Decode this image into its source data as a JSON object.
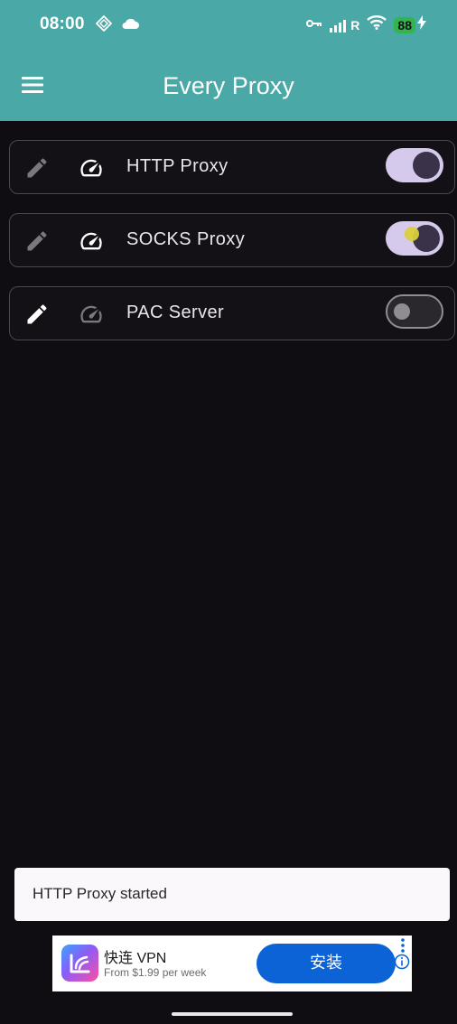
{
  "status_bar": {
    "time": "08:00",
    "battery": "88",
    "signal_text": "R"
  },
  "app_bar": {
    "title": "Every Proxy",
    "menu_icon": "menu-icon"
  },
  "proxies": [
    {
      "label": "HTTP Proxy",
      "enabled": true,
      "edit_icon": "pencil-icon",
      "speed_icon": "speedometer-icon"
    },
    {
      "label": "SOCKS Proxy",
      "enabled": true,
      "edit_icon": "pencil-icon",
      "speed_icon": "speedometer-icon"
    },
    {
      "label": "PAC Server",
      "enabled": false,
      "edit_icon": "pencil-icon",
      "speed_icon": "speedometer-icon"
    }
  ],
  "snackbar": {
    "message": "HTTP Proxy started"
  },
  "ad": {
    "title": "快连 VPN",
    "subtitle": "From $1.99 per week",
    "install_label": "安装"
  },
  "colors": {
    "app_bar": "#4aa8a6",
    "background": "#0f0d11",
    "toggle_on_track": "#d5c9ec",
    "toggle_on_knob": "#3a3248",
    "ad_button": "#0b63d6"
  }
}
